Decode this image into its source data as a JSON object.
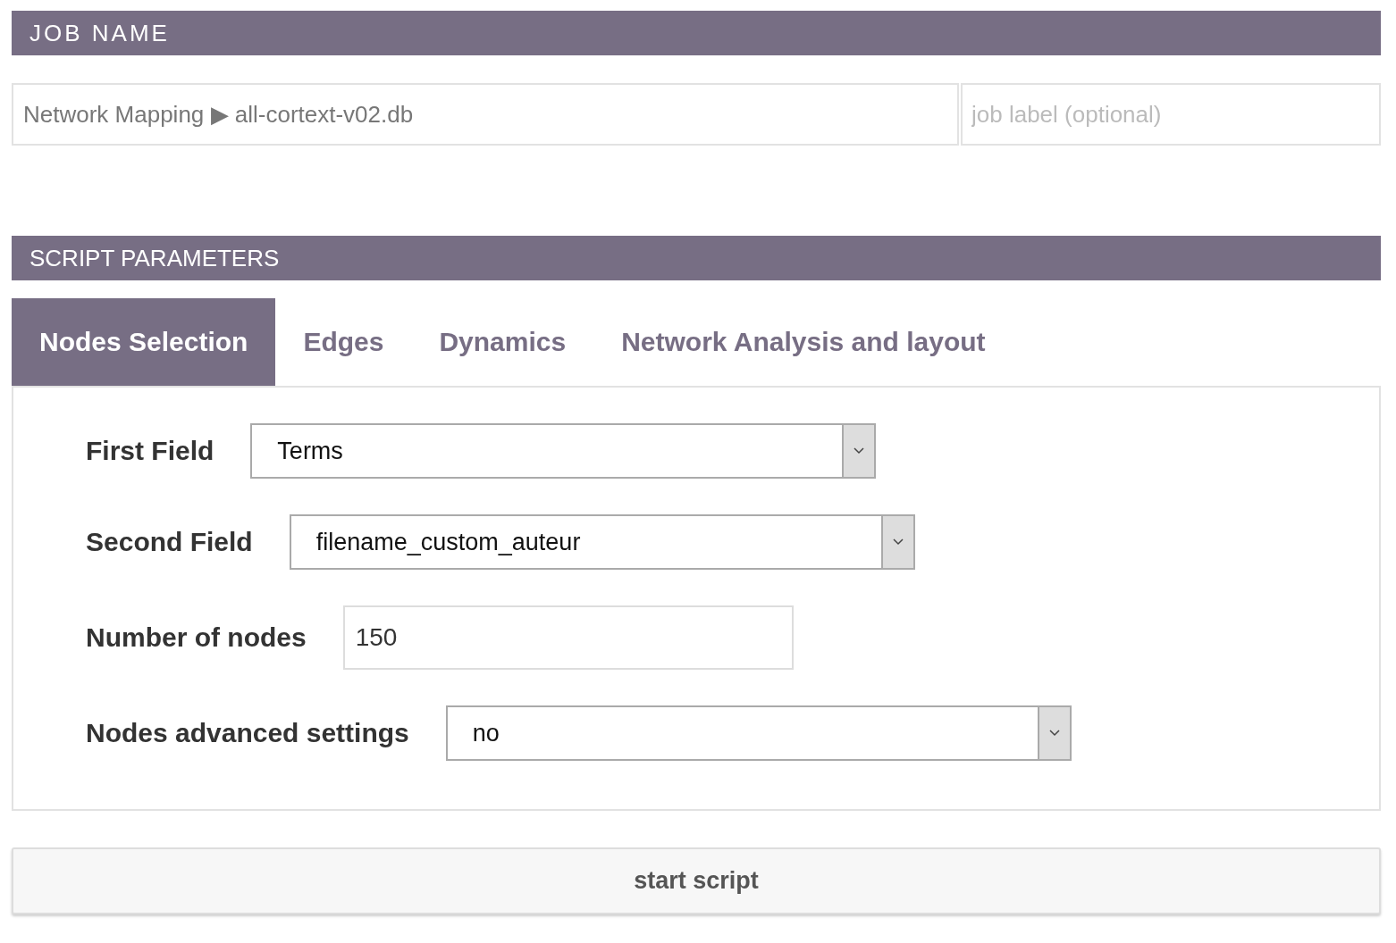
{
  "job_name": {
    "title": "JOB NAME",
    "job": "Network Mapping ▶ all-cortext-v02.db",
    "label_field": {
      "placeholder": "job label (optional)"
    }
  },
  "script_parameters": {
    "title": "SCRIPT PARAMETERS",
    "tabs": [
      {
        "label": "Nodes Selection",
        "selected": true
      },
      {
        "label": "Edges",
        "selected": false
      },
      {
        "label": "Dynamics",
        "selected": false
      },
      {
        "label": "Network Analysis and layout",
        "selected": false
      }
    ],
    "fields": [
      {
        "kind": "select",
        "label": "First Field",
        "value": "Terms"
      },
      {
        "kind": "select",
        "label": "Second Field",
        "value": "filename_custom_auteur"
      },
      {
        "kind": "number",
        "label": "Number of nodes",
        "value": "150"
      },
      {
        "kind": "select",
        "label": "Nodes advanced settings",
        "value": "no"
      }
    ]
  },
  "start_button": "start script"
}
